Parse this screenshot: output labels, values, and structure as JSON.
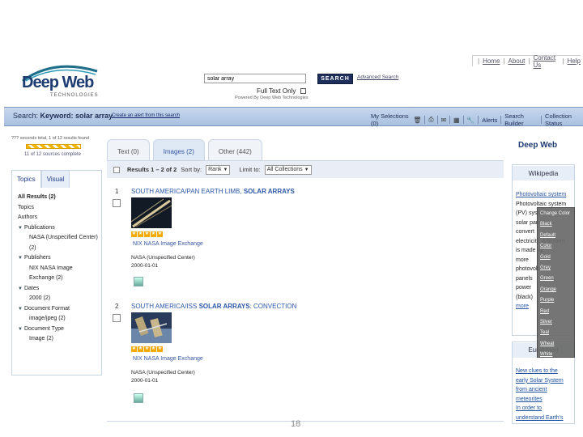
{
  "topnav": {
    "home": "Home",
    "about": "About",
    "contact": "Contact Us",
    "help": "Help"
  },
  "logo": {
    "word": "Deep Web",
    "sub": "TECHNOLOGIES"
  },
  "search": {
    "value": "solar array",
    "button": "SEARCH",
    "advanced": "Advanced Search",
    "fulltext": "Full Text Only",
    "powered": "Powered By Deep Web Technologies"
  },
  "bar": {
    "label": "Search:",
    "keyword": "Keyword: solar array",
    "create_alert": "Create an alert from this search",
    "my_selections": "My Selections (0)",
    "alerts": "Alerts",
    "search_builder": "Search Builder",
    "collection_status": "Collection Status"
  },
  "left": {
    "sources": "??? seconds total, 1 of 12 results found",
    "complete": "11 of 12 sources complete",
    "tabs": [
      "Topics",
      "Visual"
    ],
    "facets": [
      {
        "label": "All Results (2)",
        "bold": true,
        "indent": 0,
        "tri": false
      },
      {
        "label": "Topics",
        "indent": 0,
        "tri": false
      },
      {
        "label": "Authors",
        "indent": 0,
        "tri": false
      },
      {
        "label": "Publications",
        "indent": 0,
        "tri": true
      },
      {
        "label": "NASA (Unspecified Center)",
        "indent": 1,
        "tri": false
      },
      {
        "label": "(2)",
        "indent": 1,
        "tri": false
      },
      {
        "label": "Publishers",
        "indent": 0,
        "tri": true
      },
      {
        "label": "NIX NASA Image",
        "indent": 1,
        "tri": false
      },
      {
        "label": "Exchange (2)",
        "indent": 1,
        "tri": false
      },
      {
        "label": "Dates",
        "indent": 0,
        "tri": true
      },
      {
        "label": "2000 (2)",
        "indent": 1,
        "tri": false
      },
      {
        "label": "Document Format",
        "indent": 0,
        "tri": true
      },
      {
        "label": "image/jpeg (2)",
        "indent": 1,
        "tri": false
      },
      {
        "label": "Document Type",
        "indent": 0,
        "tri": true
      },
      {
        "label": "Image (2)",
        "indent": 1,
        "tri": false
      }
    ]
  },
  "center": {
    "tabs": [
      "Text (0)",
      "Images (2)",
      "Other (442)"
    ],
    "results_label": "Results 1 – 2 of 2",
    "sort_by": "Sort by:",
    "sort_value": "Rank",
    "limit": "Limit to:",
    "limit_value": "All Collections",
    "results": [
      {
        "num": "1",
        "title_a": "SOUTH AMERICA/PAN EARTH LIMB, ",
        "title_b": "SOLAR ARRAYS",
        "title_c": "",
        "source": "NIX NASA Image Exchange",
        "center": "NASA (Unspecified Center)",
        "date": "2000-01-01"
      },
      {
        "num": "2",
        "title_a": "SOUTH AMERICA/ISS ",
        "title_b": "SOLAR ARRAYS",
        "title_c": ": CONVECTION",
        "source": "NIX NASA Image Exchange",
        "center": "NASA (Unspecified Center)",
        "date": "2000-01-01"
      }
    ]
  },
  "right": {
    "logo": "Deep Web",
    "wiki_title": "Wikipedia",
    "wiki_lines": [
      "Photovoltaic system",
      "Photovoltaic system",
      "(PV) system",
      "solar panel",
      "convert",
      "electricity. A system",
      "is made up",
      "more",
      "photovoltaic",
      "panels",
      "power",
      "(black)",
      "more"
    ],
    "eureka_title": "EurekAlert",
    "eureka_lines": [
      "New clues to the",
      "early Solar System",
      "from ancient",
      "meteorites",
      "In order to",
      "understand Earth's"
    ]
  },
  "color_menu": [
    "Change Color",
    "Black",
    "Default",
    "Color",
    "Gold",
    "Grey",
    "Green",
    "Orange",
    "Purple",
    "Red",
    "Silver",
    "Teal",
    "Wheat",
    "White"
  ],
  "page_number": "18"
}
